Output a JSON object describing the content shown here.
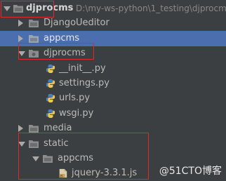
{
  "project": {
    "root_name": "djprocms",
    "root_path": "D:\\my-ws-python\\1_testing\\djprocms"
  },
  "tree": {
    "djangoueditor": "DjangoUeditor",
    "appcms": "appcms",
    "djprocms": "djprocms",
    "init_file": "__init__.py",
    "settings_file": "settings.py",
    "urls_file": "urls.py",
    "wsgi_file": "wsgi.py",
    "media": "media",
    "static": "static",
    "static_appcms": "appcms",
    "jquery_file": "jquery-3.3.1.js"
  },
  "watermark": "@51CTO博客",
  "colors": {
    "background": "#3c3f41",
    "selection": "#4b6eaf",
    "highlight_box": "#e0282f",
    "python_icon_blue": "#4a7fbf",
    "python_icon_yellow": "#f2c94c",
    "js_icon": "#c8a15a"
  }
}
